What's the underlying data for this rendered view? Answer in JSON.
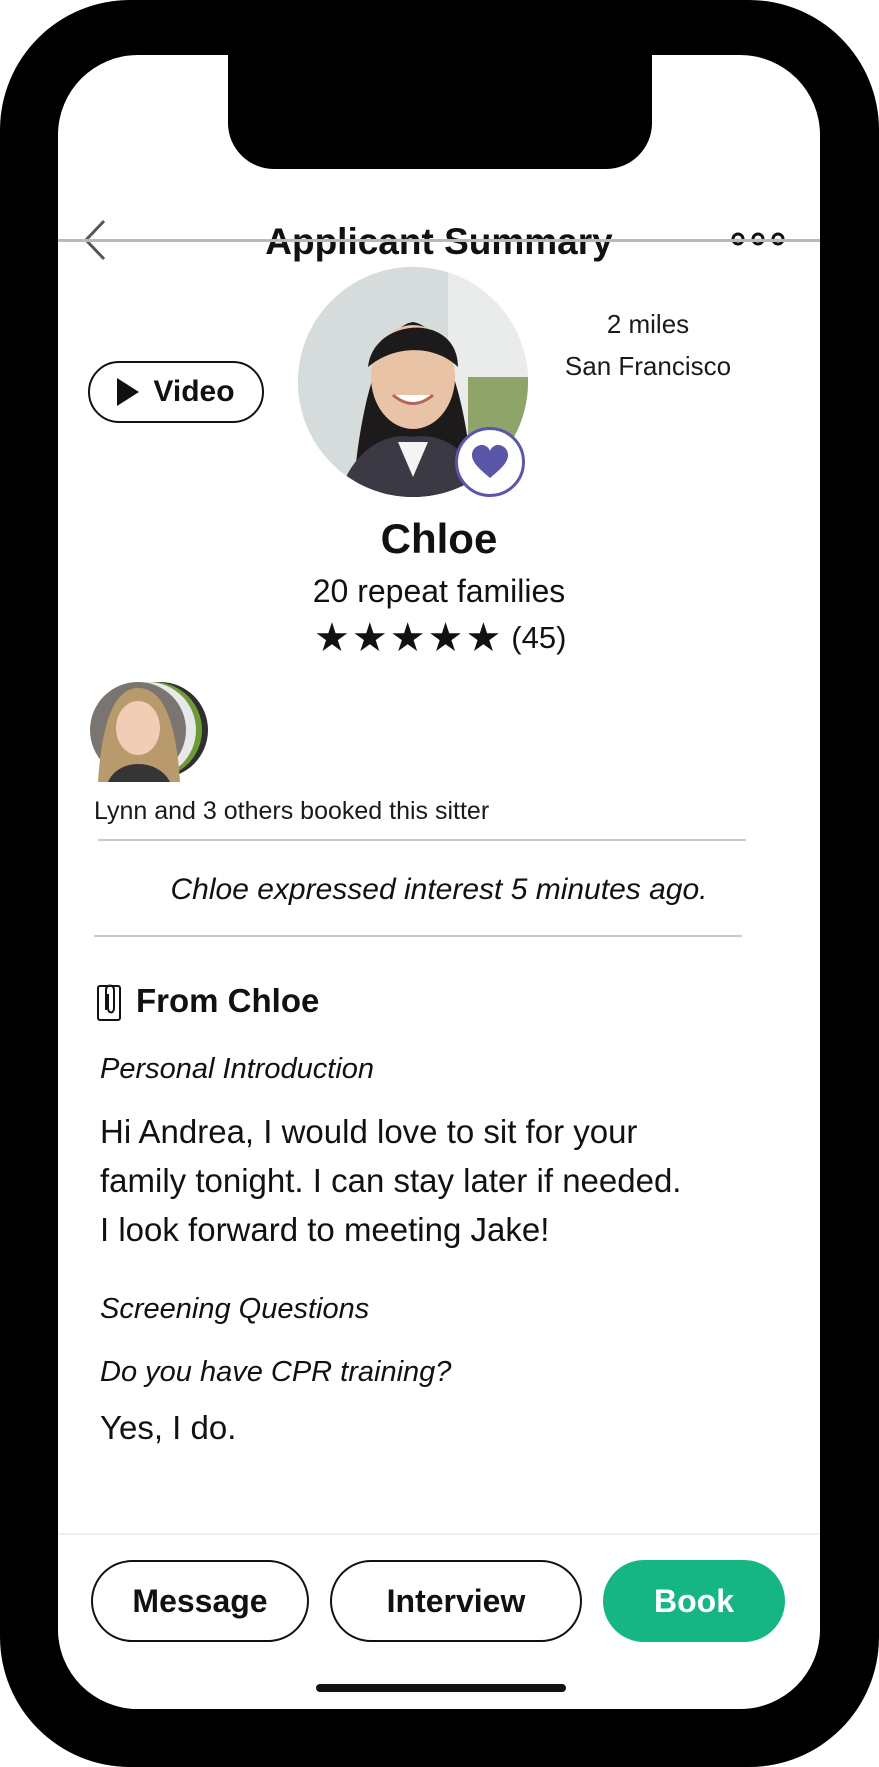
{
  "header": {
    "title": "Applicant Summary"
  },
  "profile": {
    "video_label": "Video",
    "distance": "2 miles",
    "city": "San Francisco",
    "name": "Chloe",
    "repeat_families": "20 repeat families",
    "rating_stars": 5,
    "rating_count": "(45)"
  },
  "booked": {
    "text": "Lynn and 3 others booked this sitter"
  },
  "interest": {
    "text": "Chloe expressed interest 5 minutes ago."
  },
  "from": {
    "heading": "From Chloe",
    "intro_label": "Personal Introduction",
    "intro_lines": [
      "Hi Andrea, I would love to sit for your",
      "family tonight. I can stay later if needed.",
      "I look forward to meeting Jake!"
    ],
    "screening_label": "Screening Questions",
    "question": "Do you have CPR training?",
    "answer": "Yes, I do."
  },
  "actions": {
    "message": "Message",
    "interview": "Interview",
    "book": "Book"
  },
  "colors": {
    "accent_green": "#16b584",
    "heart_purple": "#5a56a8"
  },
  "icons": [
    "back-chevron-icon",
    "more-icon",
    "play-icon",
    "heart-icon",
    "star-icon",
    "paperclip-icon"
  ]
}
